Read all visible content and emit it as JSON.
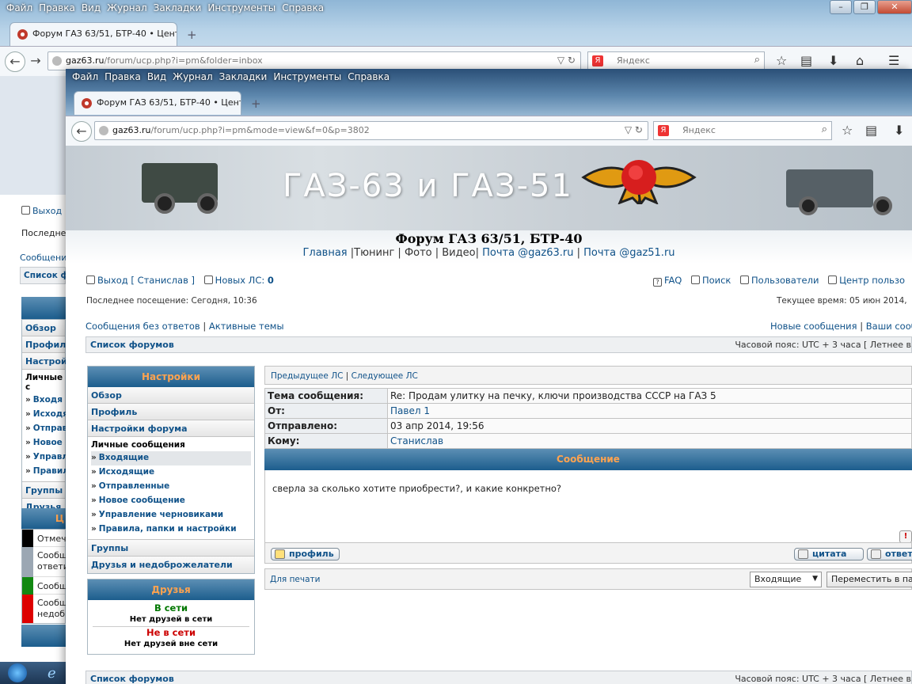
{
  "back_window": {
    "menu": [
      "Файл",
      "Правка",
      "Вид",
      "Журнал",
      "Закладки",
      "Инструменты",
      "Справка"
    ],
    "tab_title": "Форум ГАЗ 63/51, БТР-40 • Цент...",
    "url_host": "gaz63.ru",
    "url_path": "/forum/ucp.php?i=pm&folder=inbox",
    "search_placeholder": "Яндекс",
    "side_fragments": {
      "exit": "Выход",
      "last_visit": "Последнее",
      "messages": "Сообщени",
      "forum_list": "Список ф",
      "menu": [
        "Обзор",
        "Профиль",
        "Настрой"
      ],
      "pm_head": "Личные с",
      "pm": [
        "Входя",
        "Исходя",
        "Отправ",
        "Новое",
        "Управл",
        "Правил"
      ],
      "groups": "Группы",
      "friends": "Друзья и",
      "legend_head": "Ц",
      "legend": [
        "Отмеч",
        "Сообщ ответи",
        "Сообщ",
        "Сообщ недоб"
      ],
      "legend_colors": [
        "#000000",
        "#9ba7b3",
        "#118811",
        "#dd0000"
      ]
    }
  },
  "front_window": {
    "menu": [
      "Файл",
      "Правка",
      "Вид",
      "Журнал",
      "Закладки",
      "Инструменты",
      "Справка"
    ],
    "tab_title": "Форум ГАЗ 63/51, БТР-40 • Цент...",
    "url_host": "gaz63.ru",
    "url_path": "/forum/ucp.php?i=pm&mode=view&f=0&p=3802",
    "search_placeholder": "Яндекс"
  },
  "site": {
    "banner_title": "ГАЗ-63 и ГАЗ-51",
    "forum_name": "Форум ГАЗ 63/51, БТР-40",
    "top_links": {
      "main": "Главная",
      "rest1": " |Тюнинг | Фото | Видео| ",
      "mail63": "Почта @gaz63.ru",
      "sep": " | ",
      "mail51": "Почта @gaz51.ru"
    },
    "exit_label": "Выход",
    "user": "Станислав",
    "new_pm_label": "Новых ЛС:",
    "new_pm_count": "0",
    "right_links": [
      "FAQ",
      "Поиск",
      "Пользователи",
      "Центр пользо"
    ],
    "last_visit": "Последнее посещение: Сегодня, 10:36",
    "current_time": "Текущее время: 05 июн 2014,",
    "unanswered": "Сообщения без ответов",
    "active": "Активные темы",
    "new_posts": "Новые сообщения",
    "your_posts": "Ваши сооб",
    "forum_list": "Список форумов",
    "timezone": "Часовой пояс: UTC + 3 часа [ Летнее в",
    "timezone_bottom": "Часовой пояс: UTC + 3 часа [ Летнее в"
  },
  "sidebar": {
    "head": "Настройки",
    "items": [
      "Обзор",
      "Профиль",
      "Настройки форума"
    ],
    "pm_head": "Личные сообщения",
    "pm_links": [
      "Входящие",
      "Исходящие",
      "Отправленные",
      "Новое сообщение",
      "Управление черновиками",
      "Правила, папки и настройки"
    ],
    "after": [
      "Группы",
      "Друзья и недоброжелатели"
    ],
    "friends_head": "Друзья",
    "online": "В сети",
    "no_online": "Нет друзей в сети",
    "offline": "Не в сети",
    "no_offline": "Нет друзей вне сети"
  },
  "message": {
    "prev": "Предыдущее ЛС",
    "sep": " | ",
    "next": "Следующее ЛС",
    "rows": [
      {
        "k": "Тема сообщения:",
        "v": "Re: Продам улитку на печку, ключи производства СССР на ГАЗ 5",
        "link": false
      },
      {
        "k": "От:",
        "v": "Павел 1",
        "link": true
      },
      {
        "k": "Отправлено:",
        "v": "03 апр 2014, 19:56",
        "link": false
      },
      {
        "k": "Кому:",
        "v": "Станислав",
        "link": true
      }
    ],
    "head": "Сообщение",
    "body": "сверла за сколько хотите приобрести?, и какие конкретно?",
    "profile_btn": "профиль",
    "quote_btn": "цитата",
    "reply_btn": "ответ",
    "print": "Для печати",
    "folder_select": "Входящие",
    "move_btn": "Переместить в па"
  }
}
